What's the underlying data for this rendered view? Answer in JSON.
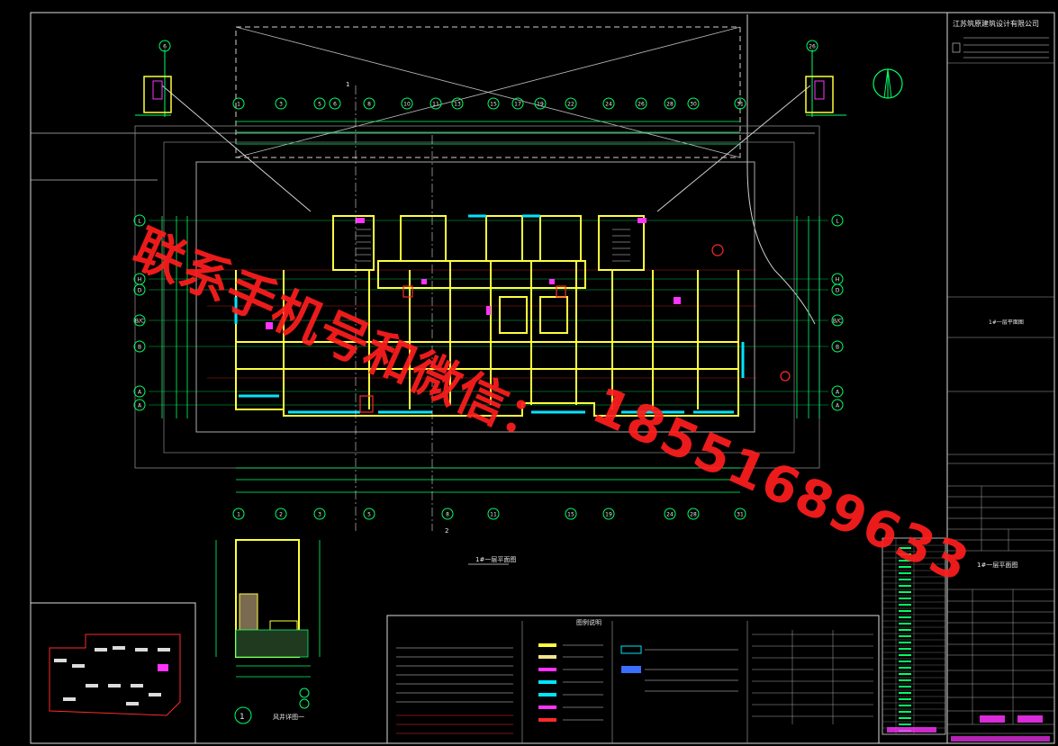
{
  "title_block": {
    "company": "江苏筑原建筑设计有限公司",
    "drawing_title": "1#一层平面图",
    "sheet_label": "1#一层平面图"
  },
  "drawing": {
    "plan_caption": "1#一层平面图",
    "detail_caption": "风井详图一",
    "detail_number": "1",
    "section_mark_1": "1",
    "section_mark_2": "2"
  },
  "axes_top": [
    "6",
    "1",
    "3",
    "5",
    "6",
    "8",
    "10",
    "11",
    "13",
    "15",
    "17",
    "19",
    "22",
    "24",
    "26",
    "28",
    "30",
    "31",
    "26"
  ],
  "axes_side_left": [
    "L",
    "H",
    "D",
    "B/C",
    "B",
    "A",
    "A"
  ],
  "axes_side_right": [
    "L",
    "H",
    "D",
    "B/C",
    "B",
    "A",
    "A"
  ],
  "axes_bottom": [
    "1",
    "2",
    "3",
    "5",
    "8",
    "11",
    "15",
    "19",
    "24",
    "28",
    "31"
  ],
  "legend": {
    "title": "图例说明"
  },
  "watermark": {
    "text_cn": "联系手机号和微信：",
    "text_phone": "18551689633"
  },
  "colors": {
    "wall": "#ffff3c",
    "wall_light": "#f0e68c",
    "axis": "#00ff66",
    "cyan": "#00e5ff",
    "magenta": "#ff33ff",
    "red": "#ff2a2a",
    "white_line": "#dcdcdc",
    "watermark": "#ff1e1e"
  }
}
